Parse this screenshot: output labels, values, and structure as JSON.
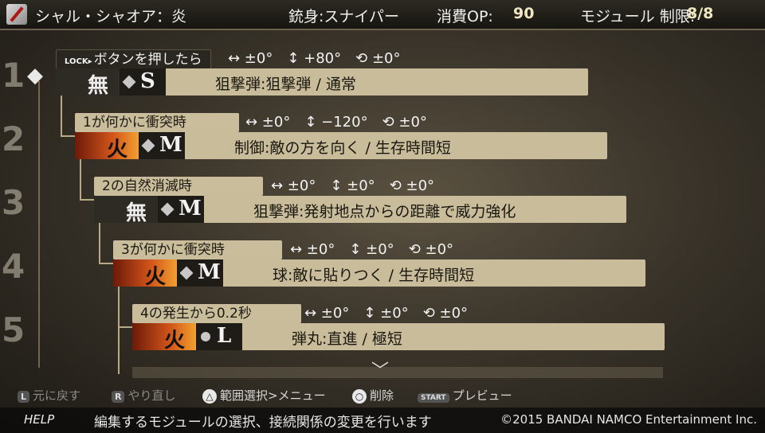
{
  "header": {
    "bullet_name": "シャル・シャオア：炎",
    "barrel_label": "銃身:スナイパー",
    "op_label": "消費OP:",
    "op_value": "90",
    "module_label": "モジュール 制限:",
    "module_value": "8/8"
  },
  "row_numbers": [
    "1",
    "2",
    "3",
    "4",
    "5"
  ],
  "modules": [
    {
      "lock": "LOCK▸",
      "condition": "ボタンを押したら",
      "h": "↔ ±0°",
      "v": "↕ +80°",
      "r": "⟲ ±0°",
      "attribute": "無",
      "size": "S",
      "description": "狙撃弾:狙撃弾 / 通常"
    },
    {
      "lock": "",
      "condition": "1が何かに衝突時",
      "h": "↔ ±0°",
      "v": "↕ −120°",
      "r": "⟲ ±0°",
      "attribute": "火",
      "size": "M",
      "description": "制御:敵の方を向く / 生存時間短"
    },
    {
      "lock": "",
      "condition": "2の自然消滅時",
      "h": "↔ ±0°",
      "v": "↕ ±0°",
      "r": "⟲ ±0°",
      "attribute": "無",
      "size": "M",
      "description": "狙撃弾:発射地点からの距離で威力強化"
    },
    {
      "lock": "",
      "condition": "3が何かに衝突時",
      "h": "↔ ±0°",
      "v": "↕ ±0°",
      "r": "⟲ ±0°",
      "attribute": "火",
      "size": "M",
      "description": "球:敵に貼りつく / 生存時間短"
    },
    {
      "lock": "",
      "condition": "4の発生から0.2秒",
      "h": "↔ ±0°",
      "v": "↕ ±0°",
      "r": "⟲ ±0°",
      "attribute": "火",
      "size": "L",
      "description": "弾丸:直進 / 極短"
    }
  ],
  "footer": {
    "undo_btn": "L",
    "undo_label": "元に戻す",
    "redo_btn": "R",
    "redo_label": "やり直し",
    "triangle_btn": "△",
    "triangle_label": "範囲選択>メニュー",
    "circle_btn": "○",
    "circle_label": "削除",
    "start_btn": "START",
    "start_label": "プレビュー",
    "help_label": "HELP",
    "help_text": "編集するモジュールの選択、接続関係の変更を行います",
    "copyright": "©2015 BANDAI NAMCO Entertainment Inc."
  },
  "colors": {
    "fire": "#d4561a",
    "panel": "#c8bc9a",
    "tab_dark": "#2a2620"
  }
}
